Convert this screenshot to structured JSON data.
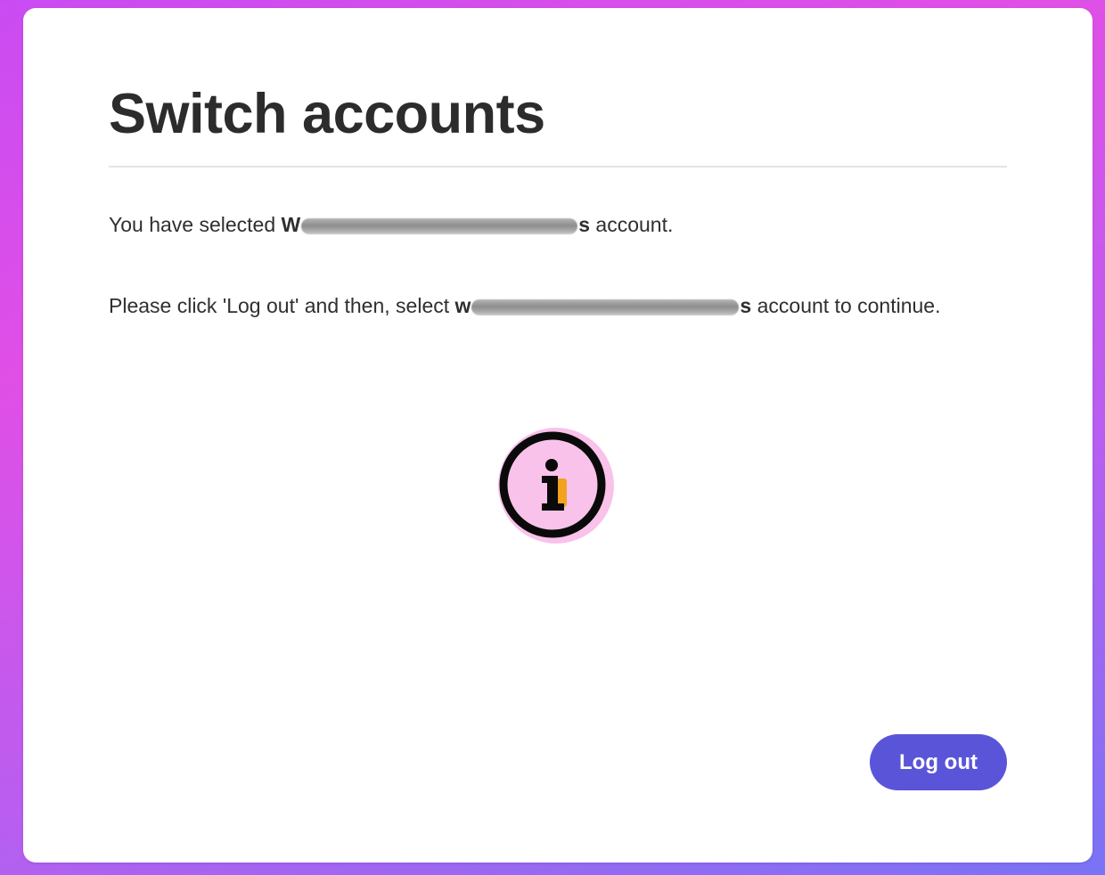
{
  "dialog": {
    "title": "Switch accounts",
    "line1_prefix": "You have selected ",
    "line1_bold_start": "W",
    "line1_bold_end": "s",
    "line1_suffix": " account.",
    "line2_prefix": "Please click 'Log out' and then, select ",
    "line2_bold_start": "w",
    "line2_bold_end": "s",
    "line2_suffix": " account to continue.",
    "info_icon_glyph": "i",
    "logout_label": "Log out"
  },
  "colors": {
    "background_gradient": [
      "#c94cf2",
      "#e04fe6",
      "#7a73f5"
    ],
    "card": "#ffffff",
    "button": "#5a55d8",
    "info_icon_fill": "#f9c2ea"
  }
}
